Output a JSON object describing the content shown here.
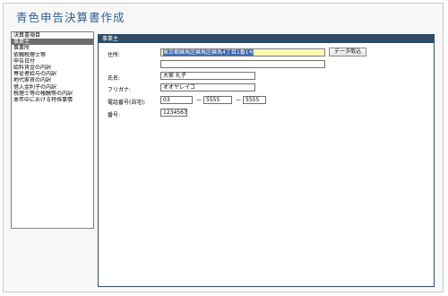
{
  "app": {
    "title": "青色申告決算書作成"
  },
  "sidebar": {
    "items": [
      {
        "label": "決算書項目",
        "selected": false
      },
      {
        "label": "事業主",
        "selected": true
      },
      {
        "label": "事業所",
        "selected": false
      },
      {
        "label": "依頼税理士等",
        "selected": false
      },
      {
        "label": "申告日付",
        "selected": false
      },
      {
        "label": "給料賃金の内訳",
        "selected": false
      },
      {
        "label": "専従者給与の内訳",
        "selected": false
      },
      {
        "label": "地代家賃の内訳",
        "selected": false
      },
      {
        "label": "借入金利子の内訳",
        "selected": false
      },
      {
        "label": "税理士等の報酬等の内訳",
        "selected": false
      },
      {
        "label": "本年中における特殊事情",
        "selected": false
      }
    ]
  },
  "panel": {
    "header": "事業主",
    "address_label": "住所:",
    "address_value": "東京都練馬区練馬区練馬4丁目1番1号",
    "address2_value": "",
    "data_import_button": "データ取込",
    "name_label": "氏名:",
    "name_value": "大家 礼子",
    "furigana_label": "フリガナ:",
    "furigana_value": "オオヤレイコ",
    "phone_label": "電話番号(自宅):",
    "phone_area": "03",
    "phone_dash": "—",
    "phone_mid": "5555",
    "phone_last": "5555",
    "number_label": "番号:",
    "number_value": "1234567"
  }
}
